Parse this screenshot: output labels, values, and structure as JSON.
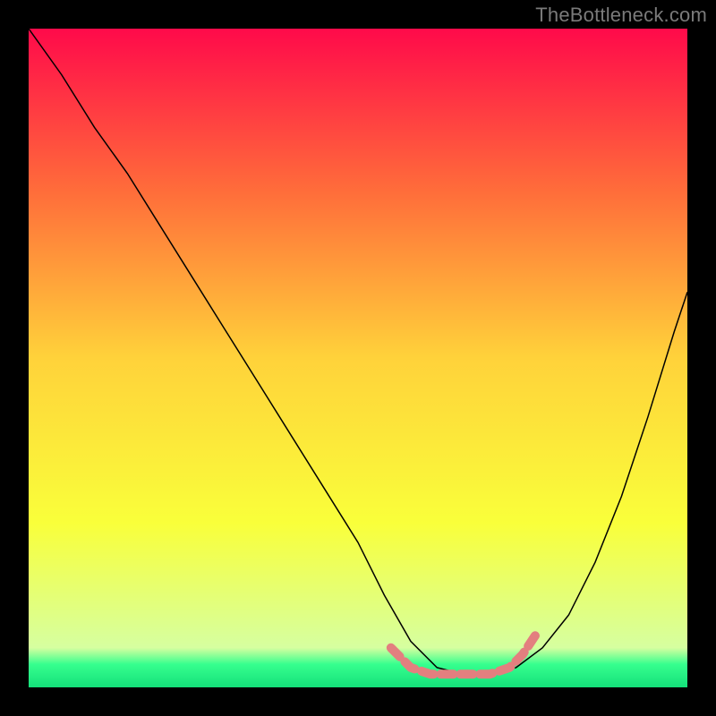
{
  "watermark": "TheBottleneck.com",
  "chart_data": {
    "type": "line",
    "title": "",
    "xlabel": "",
    "ylabel": "",
    "xlim": [
      0,
      100
    ],
    "ylim": [
      0,
      100
    ],
    "series": [
      {
        "name": "curve",
        "color": "#000000",
        "x": [
          0,
          5,
          10,
          15,
          20,
          25,
          30,
          35,
          40,
          45,
          50,
          54,
          58,
          62,
          66,
          70,
          74,
          78,
          82,
          86,
          90,
          94,
          98,
          100
        ],
        "y": [
          100,
          93,
          85,
          78,
          70,
          62,
          54,
          46,
          38,
          30,
          22,
          14,
          7,
          3,
          2,
          2,
          3,
          6,
          11,
          19,
          29,
          41,
          54,
          60
        ]
      },
      {
        "name": "flat-marker",
        "color": "#e37f7f",
        "x": [
          55,
          58,
          61,
          64,
          67,
          70,
          73,
          75,
          77
        ],
        "y": [
          6,
          3,
          2,
          2,
          2,
          2,
          3,
          5,
          8
        ]
      }
    ],
    "background_gradient": {
      "stops": [
        {
          "offset": 0.0,
          "color": "#ff0a4a"
        },
        {
          "offset": 0.25,
          "color": "#ff6e3a"
        },
        {
          "offset": 0.5,
          "color": "#ffd23a"
        },
        {
          "offset": 0.75,
          "color": "#f9ff3a"
        },
        {
          "offset": 0.94,
          "color": "#d6ffa0"
        },
        {
          "offset": 0.965,
          "color": "#36ff8e"
        },
        {
          "offset": 1.0,
          "color": "#14e07a"
        }
      ]
    }
  }
}
